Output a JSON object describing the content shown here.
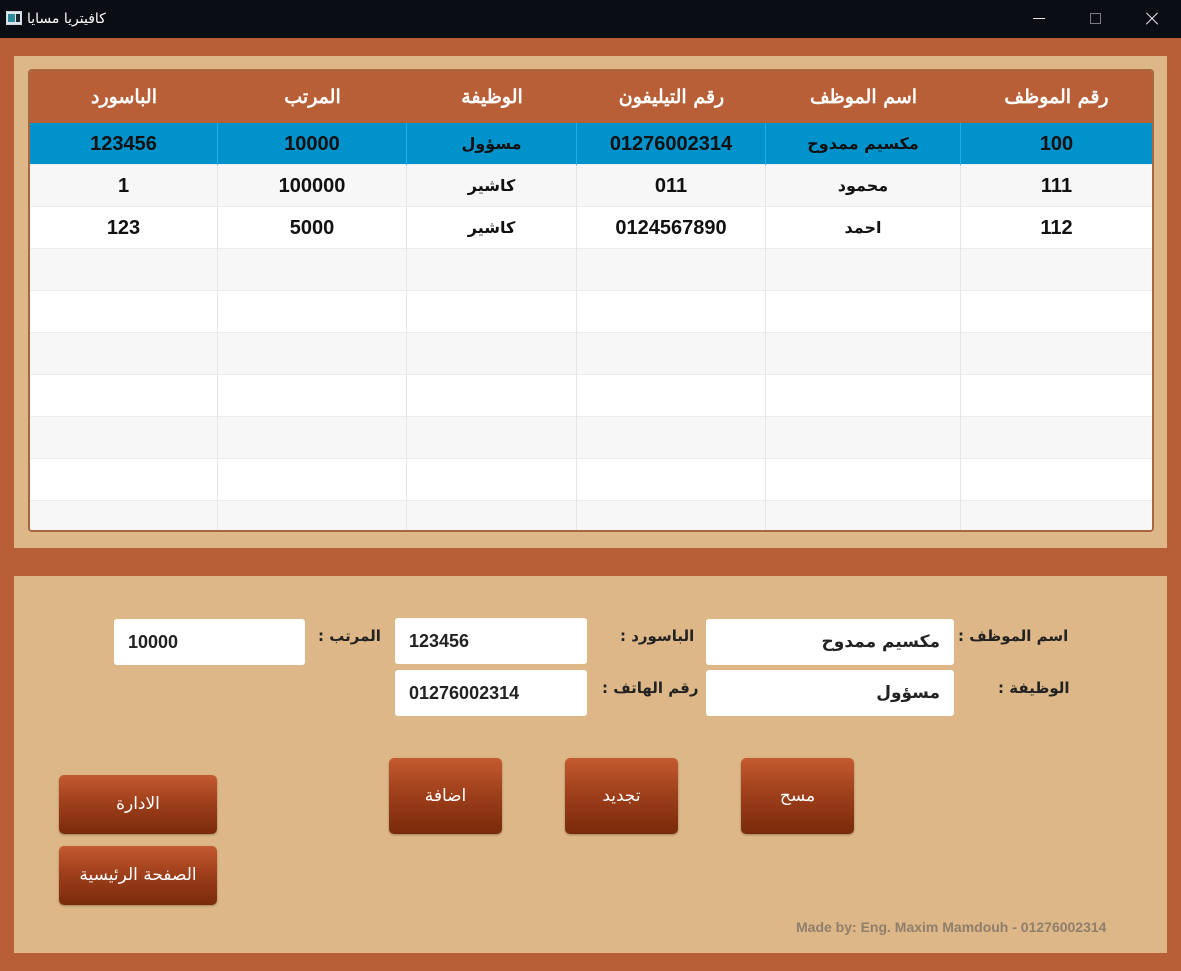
{
  "window": {
    "title": "كافيتريا مسايا"
  },
  "table": {
    "columns": [
      "الباسورد",
      "المرتب",
      "الوظيفة",
      "رقم التيليفون",
      "اسم الموظف",
      "رقم الموظف"
    ],
    "rows": [
      {
        "password": "123456",
        "salary": "10000",
        "job": "مسؤول",
        "phone": "01276002314",
        "name": "مكسيم ممدوح",
        "id": "100"
      },
      {
        "password": "1",
        "salary": "100000",
        "job": "كاشير",
        "phone": "011",
        "name": "محمود",
        "id": "111"
      },
      {
        "password": "123",
        "salary": "5000",
        "job": "كاشير",
        "phone": "0124567890",
        "name": "احمد",
        "id": "112"
      }
    ],
    "selected_row": 0
  },
  "form": {
    "name_label": "اسم الموظف :",
    "name_value": "مكسيم ممدوح",
    "job_label": "الوظيفة :",
    "job_value": "مسؤول",
    "password_label": "الباسورد :",
    "password_value": "123456",
    "phone_label": "رقم الهاتف :",
    "phone_value": "01276002314",
    "salary_label": "المرتب :",
    "salary_value": "10000"
  },
  "buttons": {
    "add": "اضافة",
    "update": "تجديد",
    "delete": "مسح",
    "admin": "الادارة",
    "home": "الصفحة الرئيسية"
  },
  "footer": {
    "credit": "Made by: Eng. Maxim Mamdouh - 01276002314"
  },
  "colors": {
    "background": "#b85f37",
    "panel": "#ddb787",
    "selection": "#0092cb",
    "button": "#a0401c"
  }
}
